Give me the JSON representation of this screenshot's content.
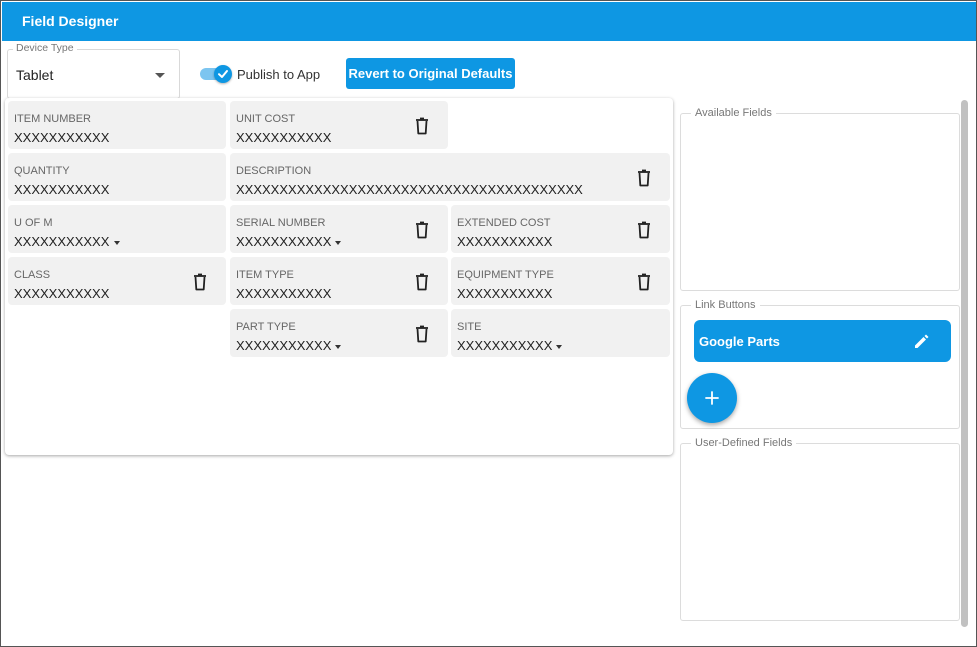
{
  "window": {
    "title": "Field Designer"
  },
  "toolbar": {
    "device_type_legend": "Device Type",
    "device_type_value": "Tablet",
    "publish_label": "Publish to App",
    "publish_on": true,
    "revert_label": "Revert to Original Defaults"
  },
  "fields": [
    {
      "label": "ITEM NUMBER",
      "value": "XXXXXXXXXXX",
      "dropdown": false,
      "deletable": false
    },
    {
      "label": "UNIT COST",
      "value": "XXXXXXXXXXX",
      "dropdown": false,
      "deletable": true
    },
    {
      "label": "QUANTITY",
      "value": "XXXXXXXXXXX",
      "dropdown": false,
      "deletable": false
    },
    {
      "label": "DESCRIPTION",
      "value": "XXXXXXXXXXXXXXXXXXXXXXXXXXXXXXXXXXXXXXXX",
      "dropdown": false,
      "deletable": true
    },
    {
      "label": "U OF M",
      "value": "XXXXXXXXXXX",
      "dropdown": true,
      "deletable": false
    },
    {
      "label": "SERIAL NUMBER",
      "value": "XXXXXXXXXXX",
      "dropdown": true,
      "deletable": true
    },
    {
      "label": "EXTENDED COST",
      "value": "XXXXXXXXXXX",
      "dropdown": false,
      "deletable": true
    },
    {
      "label": "CLASS",
      "value": "XXXXXXXXXXX",
      "dropdown": false,
      "deletable": true
    },
    {
      "label": "ITEM TYPE",
      "value": "XXXXXXXXXXX",
      "dropdown": false,
      "deletable": true
    },
    {
      "label": "EQUIPMENT TYPE",
      "value": "XXXXXXXXXXX",
      "dropdown": false,
      "deletable": true
    },
    {
      "label": "PART TYPE",
      "value": "XXXXXXXXXXX",
      "dropdown": true,
      "deletable": true
    },
    {
      "label": "SITE",
      "value": "XXXXXXXXXXX",
      "dropdown": true,
      "deletable": false
    }
  ],
  "sidebar": {
    "available_fields_legend": "Available Fields",
    "link_buttons_legend": "Link Buttons",
    "link_buttons": [
      {
        "label": "Google Parts"
      }
    ],
    "user_defined_legend": "User-Defined Fields"
  },
  "colors": {
    "accent": "#0e97e3",
    "card_bg": "#f1f1f1"
  },
  "icons": {
    "trash": "trash-icon",
    "edit": "pencil-icon",
    "add": "plus-icon",
    "check": "check-icon",
    "caret": "caret-down-icon"
  }
}
